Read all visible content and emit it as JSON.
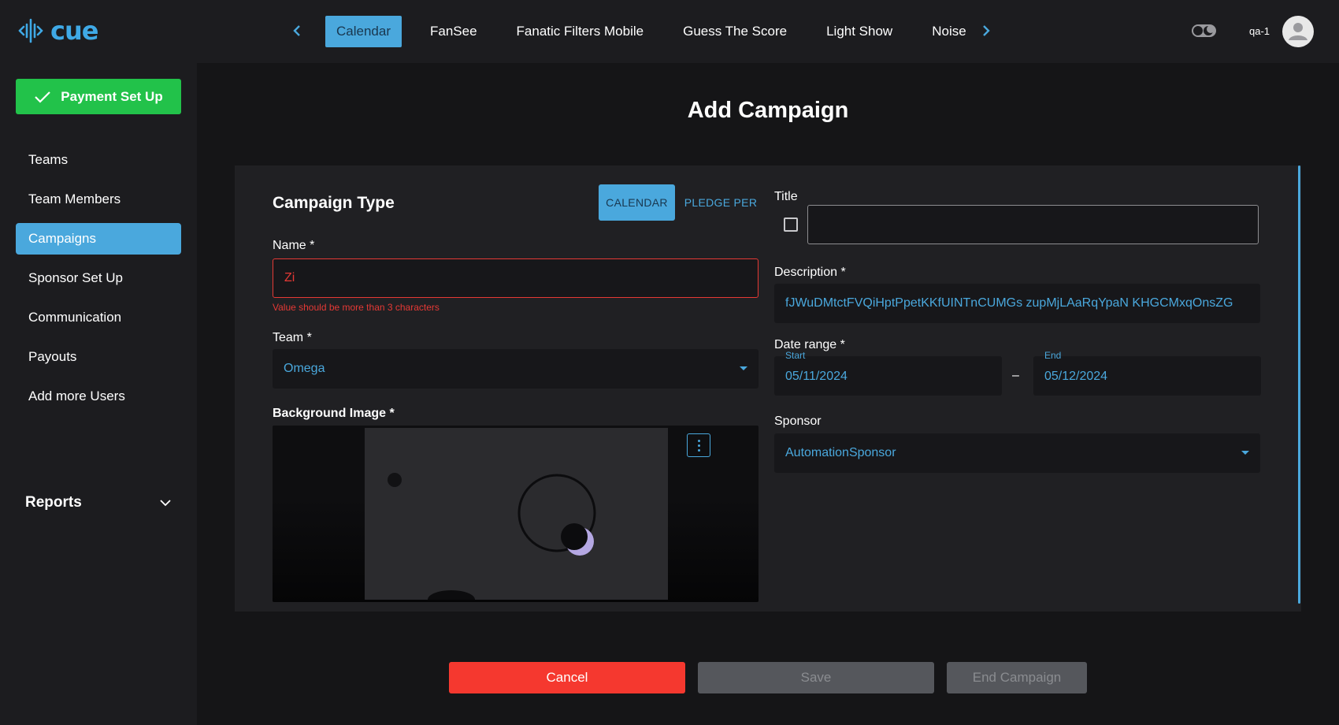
{
  "app": {
    "logo_text": "cue",
    "user": "qa-1"
  },
  "header": {
    "tabs": [
      {
        "label": "Calendar",
        "active": true
      },
      {
        "label": "FanSee",
        "active": false
      },
      {
        "label": "Fanatic Filters Mobile",
        "active": false
      },
      {
        "label": "Guess The Score",
        "active": false
      },
      {
        "label": "Light Show",
        "active": false
      },
      {
        "label": "Noise",
        "active": false
      }
    ]
  },
  "sidebar": {
    "payment_button": "Payment Set Up",
    "items": [
      {
        "label": "Teams"
      },
      {
        "label": "Team Members"
      },
      {
        "label": "Campaigns"
      },
      {
        "label": "Sponsor Set Up"
      },
      {
        "label": "Communication"
      },
      {
        "label": "Payouts"
      },
      {
        "label": "Add more Users"
      }
    ],
    "reports": "Reports"
  },
  "page": {
    "title": "Add Campaign"
  },
  "form": {
    "campaign_type_title": "Campaign Type",
    "type_buttons": {
      "calendar": "CALENDAR",
      "pledge": "PLEDGE PER"
    },
    "name_label": "Name *",
    "name_value": "Zi",
    "name_error": "Value should be more than 3 characters",
    "team_label": "Team *",
    "team_value": "Omega",
    "bg_label": "Background Image *",
    "title_label": "Title",
    "title_value": "",
    "description_label": "Description *",
    "description_value": "fJWuDMtctFVQiHptPpetKKfUINTnCUMGs zupMjLAaRqYpaN KHGCMxqOnsZG",
    "date_label": "Date range *",
    "start_label": "Start",
    "start_value": "05/11/2024",
    "date_separator": "–",
    "end_label": "End",
    "end_value": "05/12/2024",
    "sponsor_label": "Sponsor",
    "sponsor_value": "AutomationSponsor"
  },
  "actions": {
    "cancel": "Cancel",
    "save": "Save",
    "end": "End Campaign"
  },
  "colors": {
    "accent": "#4aa8dd",
    "success": "#22c24a",
    "danger": "#f5382f"
  }
}
